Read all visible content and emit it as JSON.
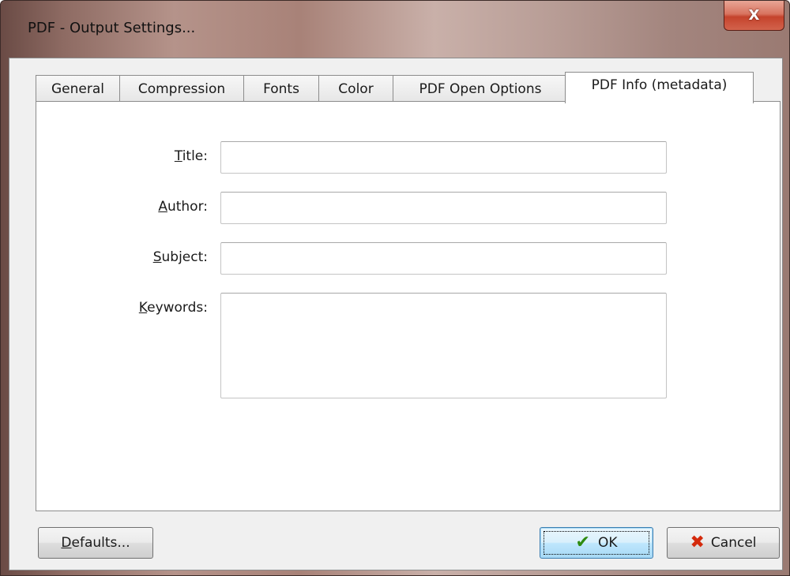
{
  "window": {
    "title": "PDF - Output Settings...",
    "close_glyph": "X",
    "close_icon": "close-icon"
  },
  "tabs": [
    {
      "label": "General",
      "active": false
    },
    {
      "label": "Compression",
      "active": false
    },
    {
      "label": "Fonts",
      "active": false
    },
    {
      "label": "Color",
      "active": false
    },
    {
      "label": "PDF Open Options",
      "active": false
    },
    {
      "label": "PDF Info (metadata)",
      "active": true
    }
  ],
  "form": {
    "title": {
      "label_mnemonic": "T",
      "label_rest": "itle:",
      "value": ""
    },
    "author": {
      "label_mnemonic": "A",
      "label_rest": "uthor:",
      "value": ""
    },
    "subject": {
      "label_mnemonic": "S",
      "label_rest": "ubject:",
      "value": ""
    },
    "keywords": {
      "label_mnemonic": "K",
      "label_rest": "eywords:",
      "value": ""
    }
  },
  "buttons": {
    "defaults": {
      "mnemonic": "D",
      "rest": "efaults..."
    },
    "ok": {
      "label": "OK",
      "icon": "checkmark-icon",
      "glyph": "✔"
    },
    "cancel": {
      "label": "Cancel",
      "icon": "x-icon",
      "glyph": "✖"
    }
  },
  "colors": {
    "ok_check": "#2e8b10",
    "cancel_x": "#d42a0c",
    "close_button": "#c5432c"
  }
}
